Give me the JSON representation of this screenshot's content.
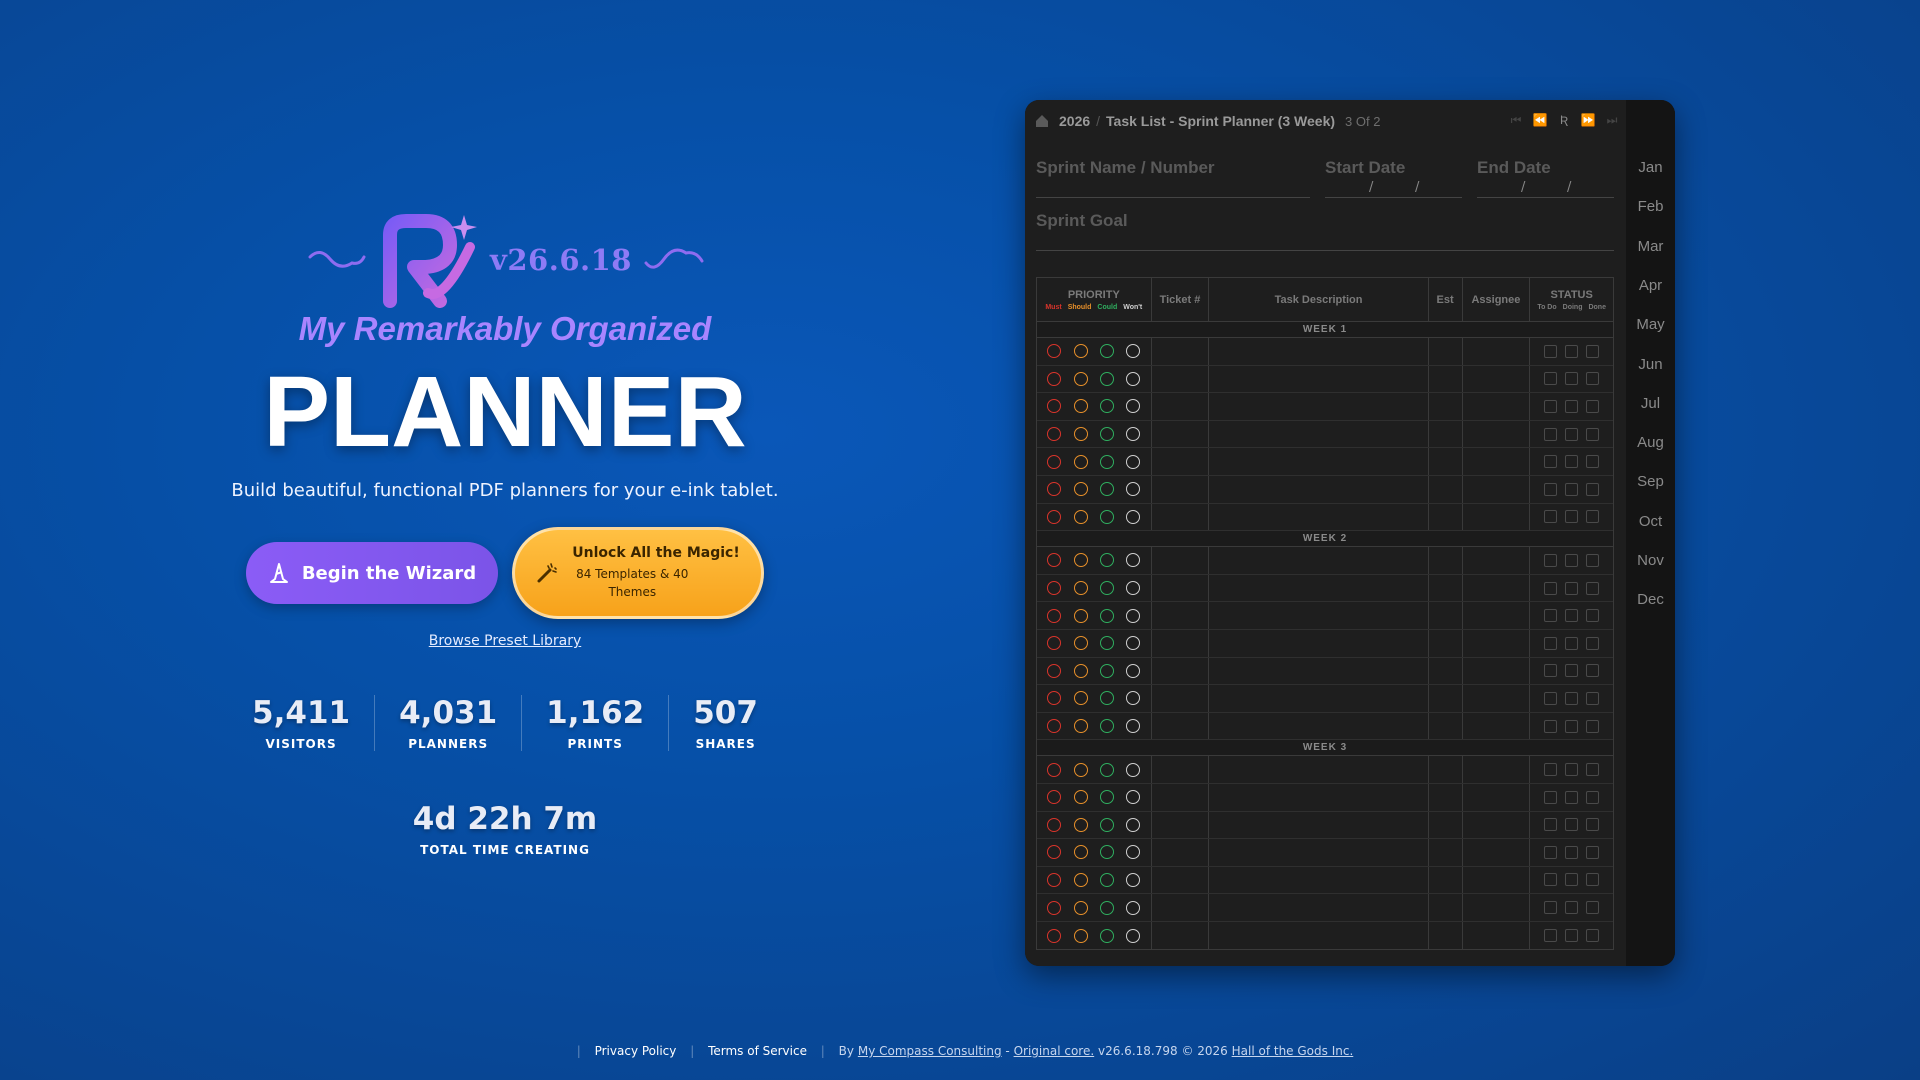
{
  "hero": {
    "version": "v26.6.18",
    "subtitle": "My Remarkably Organized",
    "title": "PLANNER",
    "tagline": "Build beautiful, functional PDF planners for your e-ink tablet.",
    "wizard_button": "Begin the Wizard",
    "magic_button_main": "Unlock All the Magic!",
    "magic_button_sub": "84 Templates & 40 Themes",
    "browse_link": "Browse Preset Library",
    "accent_purple": "#8b5cf6",
    "accent_orange": "#f7a21a"
  },
  "stats": [
    {
      "num": "5,411",
      "label": "VISITORS"
    },
    {
      "num": "4,031",
      "label": "PLANNERS"
    },
    {
      "num": "1,162",
      "label": "PRINTS"
    },
    {
      "num": "507",
      "label": "SHARES"
    }
  ],
  "time": {
    "num": "4d 22h 7m",
    "label": "TOTAL TIME CREATING"
  },
  "preview": {
    "year": "2026",
    "crumb": "Task List - Sprint Planner (3 Week)",
    "count": "3 Of 2",
    "fields": {
      "sprint_name": "Sprint Name / Number",
      "start_date": "Start Date",
      "end_date": "End Date",
      "sprint_goal": "Sprint Goal"
    },
    "headers": {
      "priority": "PRIORITY",
      "must": "Must",
      "should": "Should",
      "could": "Could",
      "wont": "Won't",
      "ticket": "Ticket #",
      "description": "Task Description",
      "est": "Est",
      "assignee": "Assignee",
      "status": "STATUS",
      "todo": "To Do",
      "doing": "Doing",
      "done": "Done"
    },
    "weeks": [
      "WEEK 1",
      "WEEK 2",
      "WEEK 3"
    ],
    "rows_per_week": 7,
    "priority_colors": [
      "#d9342b",
      "#e8902a",
      "#2fae5f",
      "#d0d0d0"
    ],
    "months": [
      "Jan",
      "Feb",
      "Mar",
      "Apr",
      "May",
      "Jun",
      "Jul",
      "Aug",
      "Sep",
      "Oct",
      "Nov",
      "Dec"
    ]
  },
  "footer": {
    "privacy": "Privacy Policy",
    "terms": "Terms of Service",
    "by": "By",
    "company": "My Compass Consulting",
    "dash": "-",
    "original": "Original core.",
    "build": "v26.6.18.798 © 2026",
    "owner": "Hall of the Gods Inc."
  }
}
